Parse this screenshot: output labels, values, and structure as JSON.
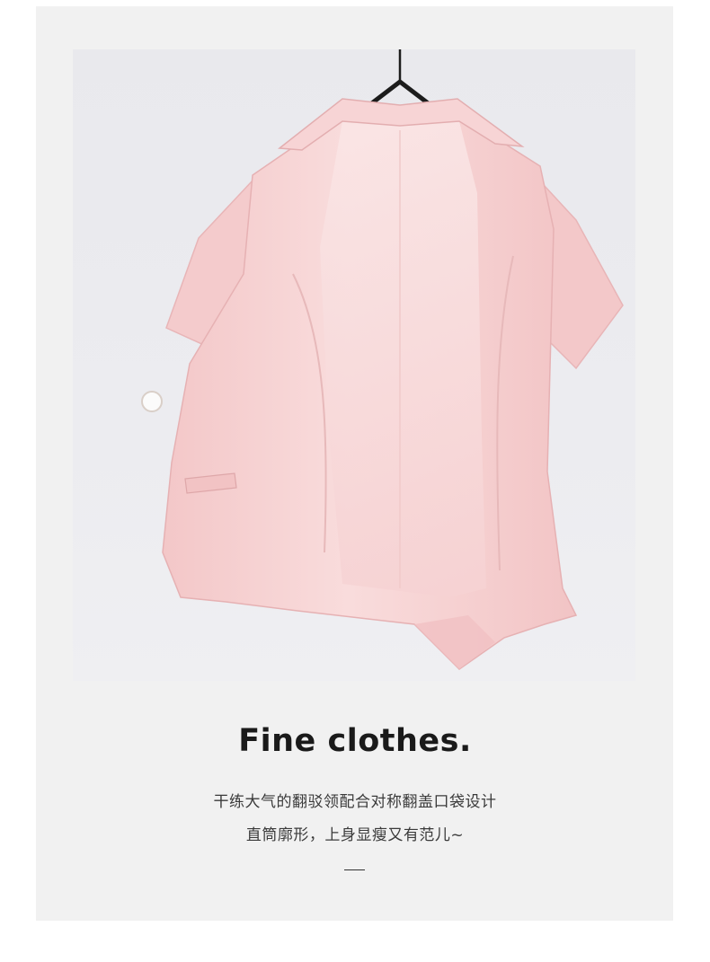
{
  "headline": "Fine clothes.",
  "description_line1": "干练大气的翻驳领配合对称翻盖口袋设计",
  "description_line2": "直筒廓形，上身显瘦又有范儿~",
  "divider": "—",
  "colors": {
    "card_background": "#f1f1f1",
    "garment": "#f6cfd0",
    "text": "#1a1a1a"
  }
}
